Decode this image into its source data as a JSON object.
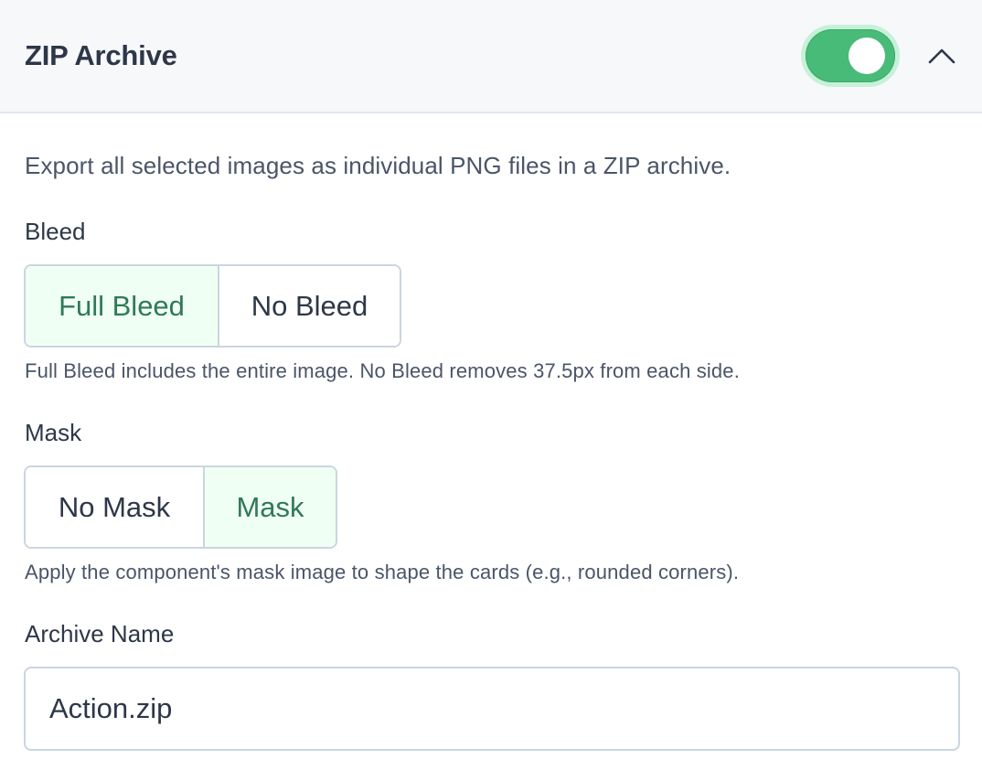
{
  "header": {
    "title": "ZIP Archive",
    "toggle_on": true,
    "toggle_color": "#48bb78",
    "collapse_icon": "chevron-up-icon"
  },
  "description": "Export all selected images as individual PNG files in a ZIP archive.",
  "bleed": {
    "label": "Bleed",
    "options": [
      "Full Bleed",
      "No Bleed"
    ],
    "selected": "Full Bleed",
    "help": "Full Bleed includes the entire image. No Bleed removes 37.5px from each side."
  },
  "mask": {
    "label": "Mask",
    "options": [
      "No Mask",
      "Mask"
    ],
    "selected": "Mask",
    "help": "Apply the component's mask image to shape the cards (e.g., rounded corners)."
  },
  "archive_name": {
    "label": "Archive Name",
    "value": "Action.zip"
  },
  "colors": {
    "accent": "#48bb78",
    "selected_bg": "#f0fff4",
    "selected_text": "#2f7a55",
    "border": "#cbd5e0"
  }
}
